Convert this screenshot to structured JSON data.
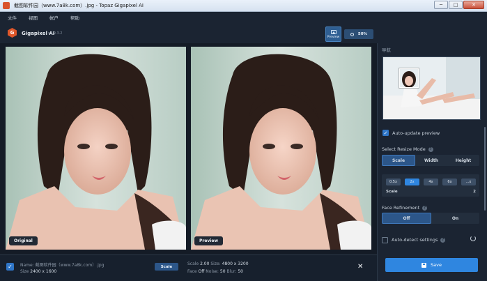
{
  "window": {
    "title": "截图软件园（www.7a8k.com）.jpg - Topaz Gigapixel AI",
    "app_icon": "app-icon",
    "min": "─",
    "max": "□",
    "close": "✕"
  },
  "menu": [
    "文件",
    "视图",
    "帐户",
    "帮助"
  ],
  "header": {
    "app_name": "Gigapixel AI",
    "version": "v4.9.3.2",
    "logo_letter": "G",
    "preview_label": "Preview",
    "zoom_label": "50%"
  },
  "viewer": {
    "original_label": "Original",
    "preview_label": "Preview"
  },
  "file": {
    "checked": "✓",
    "name_label": "Name:",
    "name_value": "截图软件园（www.7a8k.com）.jpg",
    "size_label": "Size",
    "size_value": "2400 x 1600",
    "mode_chip": "Scale",
    "scale_label": "Scale",
    "scale_value": "2.00",
    "out_size_label": "Size:",
    "out_size_value": "4800 x 3200",
    "face_label": "Face",
    "face_value": "Off",
    "noise_label": "Noise:",
    "noise_value": "50",
    "blur_label": "Blur:",
    "blur_value": "50",
    "close_icon": "✕"
  },
  "panel": {
    "nav_title": "导航",
    "auto_update": "Auto-update preview",
    "resize_mode_title": "Select Resize Mode",
    "resize_modes": [
      "Scale",
      "Width",
      "Height"
    ],
    "scale_options": [
      "0.5x",
      "2x",
      "4x",
      "6x",
      "...x"
    ],
    "scale_label": "Scale",
    "scale_value": "2",
    "face_title": "Face Refinement",
    "face_options": [
      "Off",
      "On"
    ],
    "auto_detect": "Auto-detect settings",
    "save_label": "Save",
    "help": "?",
    "check": "✓"
  },
  "colors": {
    "background": "#1b2432",
    "accent": "#2f86e0",
    "active_segment": "#2c5689"
  }
}
